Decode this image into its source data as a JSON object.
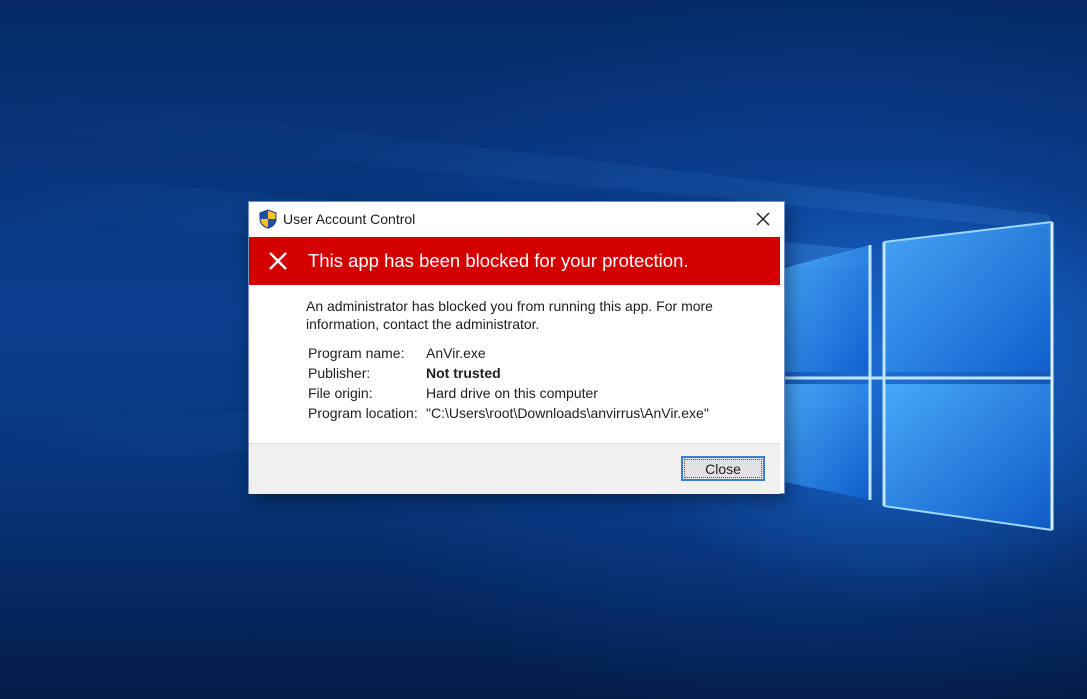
{
  "dialog": {
    "title": "User Account Control",
    "banner_text": "This app has been blocked for your protection.",
    "message": "An administrator has blocked you from running this app. For more information, contact the administrator.",
    "details": [
      {
        "label": "Program name:",
        "value": "AnVir.exe",
        "bold": false
      },
      {
        "label": "Publisher:",
        "value": "Not trusted",
        "bold": true
      },
      {
        "label": "File origin:",
        "value": "Hard drive on this computer",
        "bold": false
      },
      {
        "label": "Program location:",
        "value": "\"C:\\Users\\root\\Downloads\\anvirrus\\AnVir.exe\"",
        "bold": false
      }
    ],
    "close_button_label": "Close",
    "icons": {
      "title": "uac-shield-icon",
      "banner": "blocked-x-icon",
      "close": "close-icon"
    },
    "colors": {
      "banner": "#d40000",
      "focus_border": "#3c7fd0",
      "footer": "#f0f0f0"
    }
  },
  "desktop": {
    "wallpaper": "windows-10-logo-wallpaper"
  }
}
